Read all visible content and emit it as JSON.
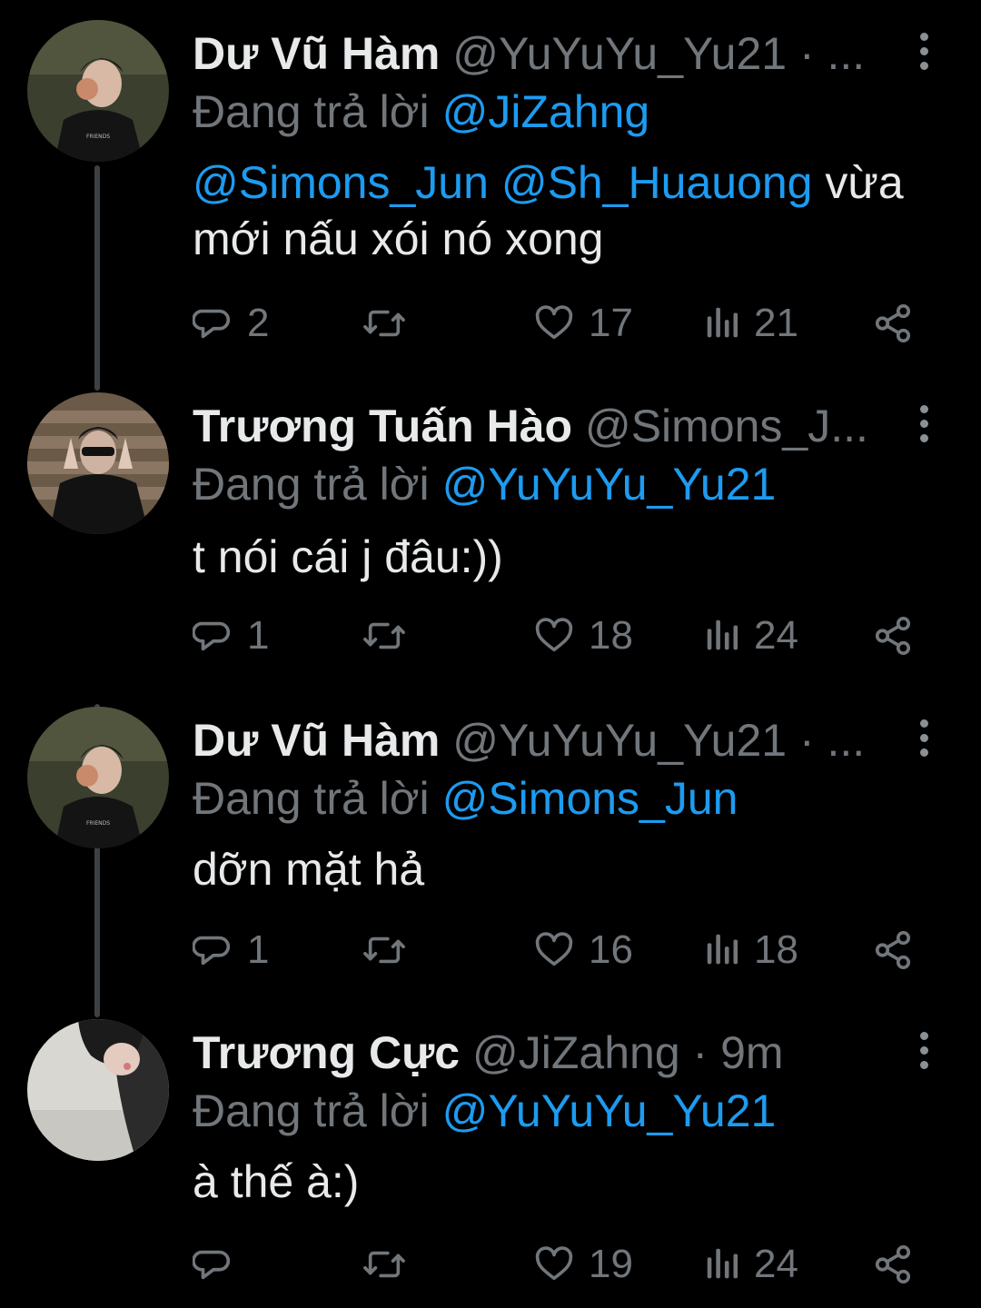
{
  "tweets": [
    {
      "name": "Dư Vũ Hàm",
      "handle": "@YuYuYu_Yu21",
      "meta": " · ...",
      "reply_prefix": "Đang trả lời",
      "reply_to": "@JiZahng",
      "body": [
        {
          "mention": "@Simons_Jun"
        },
        {
          "text": " "
        },
        {
          "mention": "@Sh_Huauong"
        },
        {
          "text": " vừa mới nấu xói nó xong"
        }
      ],
      "counts": {
        "replies": "2",
        "retweets": "",
        "likes": "17",
        "views": "21"
      }
    },
    {
      "name": "Trương Tuấn Hào",
      "handle": "@Simons_J...",
      "meta": "",
      "reply_prefix": "Đang trả lời",
      "reply_to": "@YuYuYu_Yu21",
      "body": [
        {
          "text": "t nói cái j đâu:))"
        }
      ],
      "counts": {
        "replies": "1",
        "retweets": "",
        "likes": "18",
        "views": "24"
      }
    },
    {
      "name": "Dư Vũ Hàm",
      "handle": "@YuYuYu_Yu21",
      "meta": " · ...",
      "reply_prefix": "Đang trả lời",
      "reply_to": "@Simons_Jun",
      "body": [
        {
          "text": "dỡn mặt hả"
        }
      ],
      "counts": {
        "replies": "1",
        "retweets": "",
        "likes": "16",
        "views": "18"
      }
    },
    {
      "name": "Trương Cực",
      "handle": "@JiZahng",
      "meta": " · 9m",
      "reply_prefix": "Đang trả lời",
      "reply_to": "@YuYuYu_Yu21",
      "body": [
        {
          "text": "à thế à:)"
        }
      ],
      "counts": {
        "replies": "",
        "retweets": "",
        "likes": "19",
        "views": "24"
      }
    }
  ],
  "icons": {
    "reply": "reply-icon",
    "retweet": "retweet-icon",
    "like": "heart-icon",
    "views": "views-icon",
    "share": "share-icon",
    "more": "more-vertical-icon"
  },
  "colors": {
    "background": "#000000",
    "text": "#e7e9ea",
    "secondary": "#71767b",
    "mention": "#1d9bf0",
    "thread_line": "#3e4144"
  }
}
